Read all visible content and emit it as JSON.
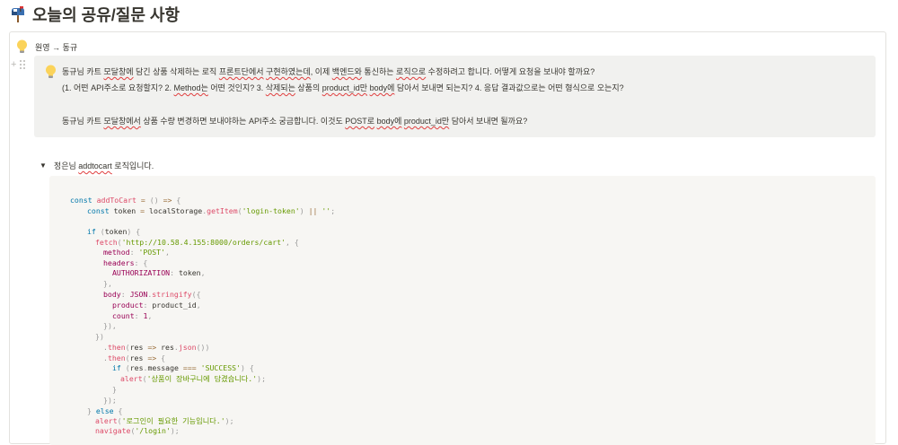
{
  "page": {
    "title": "오늘의 공유/질문 사항",
    "icon": "mailbox-icon"
  },
  "callout": {
    "header": "원영 → 동규",
    "icon": "lightbulb-icon"
  },
  "question": {
    "icon": "lightbulb-icon",
    "line1": {
      "a": "동규님 카트 ",
      "b": "모달창에",
      "c": " 담긴 상품 삭제하는 로직 ",
      "d": "프론트단에서",
      "e": " ",
      "f": "구현하였는데",
      "g": ", 이제 ",
      "h": "백엔드와",
      "i": " 통신하는 ",
      "j": "로직으로",
      "k": " 수정하려고 합니다. 어떻게 요청을 보내야 할까요?"
    },
    "line2": {
      "a": "(1. 어떤 API주소로 요청할지? 2. ",
      "b": "Method는",
      "c": " 어떤 것인지? 3. ",
      "d": "삭제되는",
      "e": " 상품의 ",
      "f": "product_id만",
      "g": " ",
      "h": "body에",
      "i": " 담아서 보내면 되는지? 4. 응답 결과값으로는 어떤 형식으로 오는지?"
    },
    "line3": {
      "a": "동규님 카트 ",
      "b": "모달창에서",
      "c": " 상품 수량 변경하면 보내야하는 API주소 궁금합니다. 이것도 ",
      "d": "POST로",
      "e": " ",
      "f": "body에",
      "g": " ",
      "h": "product_id만",
      "i": " 담아서 보내면 될까요?"
    }
  },
  "toggle": {
    "a": "정은님 ",
    "b": "addtocart",
    "c": " 로직입니다."
  },
  "code": {
    "l1": [
      "const",
      " ",
      "addToCart",
      " ",
      "=",
      " ",
      "()",
      " ",
      "=>",
      " ",
      "{"
    ],
    "l2": [
      "const",
      " token ",
      "=",
      " localStorage",
      ".",
      "getItem",
      "(",
      "'login-token'",
      ")",
      " ",
      "||",
      " ",
      "''",
      ";"
    ],
    "l3": [
      "if",
      " ",
      "(",
      "token",
      ")",
      " ",
      "{"
    ],
    "l4": [
      "fetch",
      "(",
      "'http://10.58.4.155:8000/orders/cart'",
      ",",
      " ",
      "{"
    ],
    "l5": [
      "method",
      ":",
      " ",
      "'POST'",
      ","
    ],
    "l6": [
      "headers",
      ":",
      " ",
      "{"
    ],
    "l7": [
      "AUTHORIZATION",
      ":",
      " token",
      ","
    ],
    "l8": [
      "}",
      ","
    ],
    "l9": [
      "body",
      ":",
      " ",
      "JSON",
      ".",
      "stringify",
      "(",
      "{"
    ],
    "l10": [
      "product",
      ":",
      " product_id",
      ","
    ],
    "l11": [
      "count",
      ":",
      " ",
      "1",
      ","
    ],
    "l12": [
      "}",
      ")",
      ","
    ],
    "l13": [
      "}",
      ")"
    ],
    "l14": [
      ".",
      "then",
      "(",
      "res",
      " ",
      "=>",
      " res",
      ".",
      "json",
      "(",
      ")",
      ")"
    ],
    "l15": [
      ".",
      "then",
      "(",
      "res",
      " ",
      "=>",
      " ",
      "{"
    ],
    "l16": [
      "if",
      " ",
      "(",
      "res",
      ".",
      "message ",
      "===",
      " ",
      "'SUCCESS'",
      ")",
      " ",
      "{"
    ],
    "l17": [
      "alert",
      "(",
      "'상품이 장바구니에 담겼습니다.'",
      ")",
      ";"
    ],
    "l18": [
      "}"
    ],
    "l19": [
      "}",
      ")",
      ";"
    ],
    "l20": [
      "}",
      " ",
      "else",
      " ",
      "{"
    ],
    "l21": [
      "alert",
      "(",
      "'로그인이 필요한 기능입니다.'",
      ")",
      ";"
    ],
    "l22": [
      "navigate",
      "(",
      "'/login'",
      ")",
      ";"
    ]
  }
}
